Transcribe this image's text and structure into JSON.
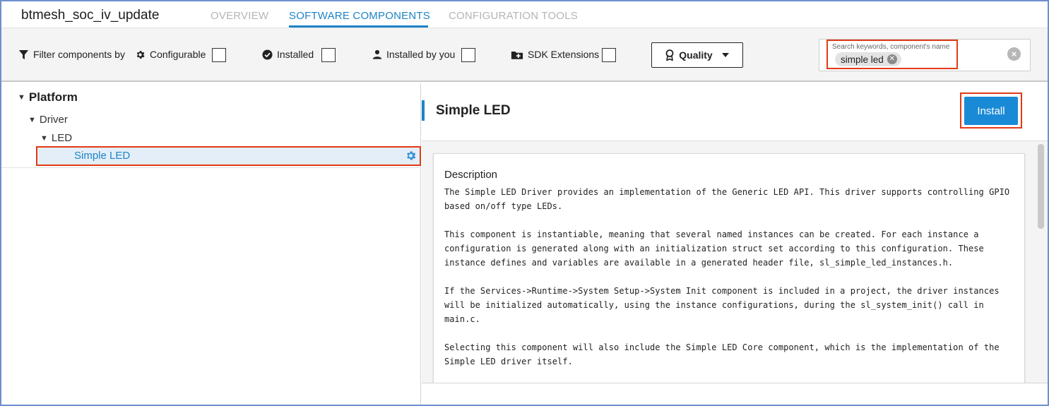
{
  "project": {
    "name": "btmesh_soc_iv_update"
  },
  "tabs": [
    {
      "label": "OVERVIEW",
      "active": false
    },
    {
      "label": "SOFTWARE COMPONENTS",
      "active": true
    },
    {
      "label": "CONFIGURATION TOOLS",
      "active": false
    }
  ],
  "filters": {
    "label": "Filter components by",
    "configurable": {
      "label": "Configurable",
      "checked": false
    },
    "installed": {
      "label": "Installed",
      "checked": false
    },
    "installed_by_you": {
      "label": "Installed by you",
      "checked": false
    },
    "sdk_extensions": {
      "label": "SDK Extensions",
      "checked": false
    },
    "quality": {
      "label": "Quality"
    }
  },
  "search": {
    "placeholder": "Search keywords, component's name",
    "chip": "simple led"
  },
  "tree": {
    "platform": "Platform",
    "driver": "Driver",
    "led": "LED",
    "selected": "Simple LED"
  },
  "detail": {
    "title": "Simple LED",
    "install_label": "Install",
    "description_title": "Description",
    "paragraphs": [
      "The Simple LED Driver provides an implementation of the Generic LED API. This driver supports controlling GPIO\nbased on/off type LEDs.",
      "This component is instantiable, meaning that several named instances can be created. For each instance a\nconfiguration is generated along with an initialization struct set according to this configuration. These\ninstance defines and variables are available in a generated header file, sl_simple_led_instances.h.",
      "If the Services->Runtime->System Setup->System Init component is included in a project, the driver instances\nwill be initialized automatically, using the instance configurations, during the sl_system_init() call in\nmain.c.",
      "Selecting this component will also include the Simple LED Core component, which is the implementation of the\nSimple LED driver itself."
    ]
  },
  "colors": {
    "accent": "#1d84c6",
    "install_button": "#1a8ad6",
    "highlight_box": "#e23a17",
    "selected_row": "#e3eef8"
  },
  "icons": [
    "filter-icon",
    "gear-icon",
    "check-circle-icon",
    "person-icon",
    "sdk-extension-icon",
    "ribbon-icon",
    "caret-down-icon",
    "clear-icon",
    "settings-icon"
  ]
}
